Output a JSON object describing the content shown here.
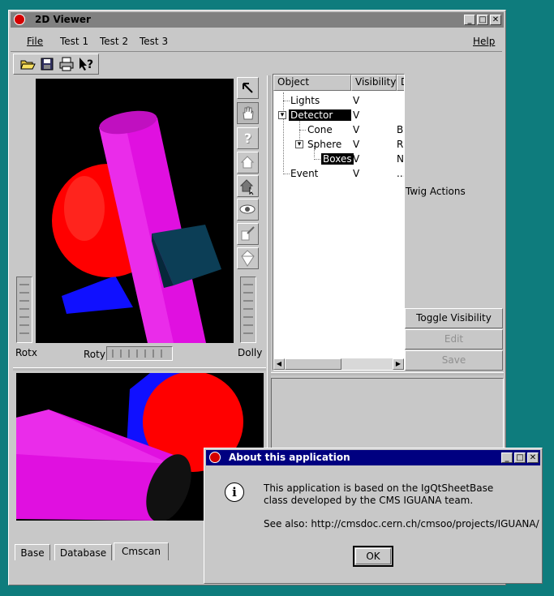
{
  "main_window": {
    "title": "2D Viewer",
    "menu": {
      "file": "File",
      "test1": "Test 1",
      "test2": "Test 2",
      "test3": "Test 3",
      "help": "Help"
    },
    "controls": {
      "rotx": "Rotx",
      "roty": "Roty",
      "dolly": "Dolly"
    },
    "tree": {
      "columns": [
        "Object",
        "Visibility",
        "D"
      ],
      "rows": [
        {
          "name": "Lights",
          "visibility": "V",
          "detail": ""
        },
        {
          "name": "Detector",
          "visibility": "V",
          "detail": ""
        },
        {
          "name": "Cone",
          "visibility": "V",
          "detail": "B"
        },
        {
          "name": "Sphere",
          "visibility": "V",
          "detail": "R"
        },
        {
          "name": "Boxes",
          "visibility": "V",
          "detail": "N"
        },
        {
          "name": "Event",
          "visibility": "V",
          "detail": "..."
        }
      ],
      "expand_symbol": "▾"
    },
    "twig_label": "Twig Actions",
    "buttons": {
      "toggle": "Toggle Visibility",
      "edit": "Edit",
      "save": "Save"
    },
    "tabs": [
      "Base",
      "Database",
      "Cmscan"
    ]
  },
  "dialog": {
    "title": "About this application",
    "line1": "This application is based on the IgQtSheetBase",
    "line2": "class developed by the CMS IGUANA team.",
    "line3": "See also:  http://cmsdoc.cern.ch/cmsoo/projects/IGUANA/",
    "ok": "OK",
    "info_symbol": "i"
  },
  "colors": {
    "desktop": "#0e7c7d",
    "window": "#c8c8c8",
    "titlebar_active": "#000080",
    "titlebar_inactive": "#808080",
    "cylinder": "#e010e0",
    "sphere": "#ff0000",
    "cone": "#1010ff",
    "box": "#0c3e56"
  },
  "window_controls": {
    "minimize": "_",
    "maximize": "□",
    "close": "✕"
  }
}
